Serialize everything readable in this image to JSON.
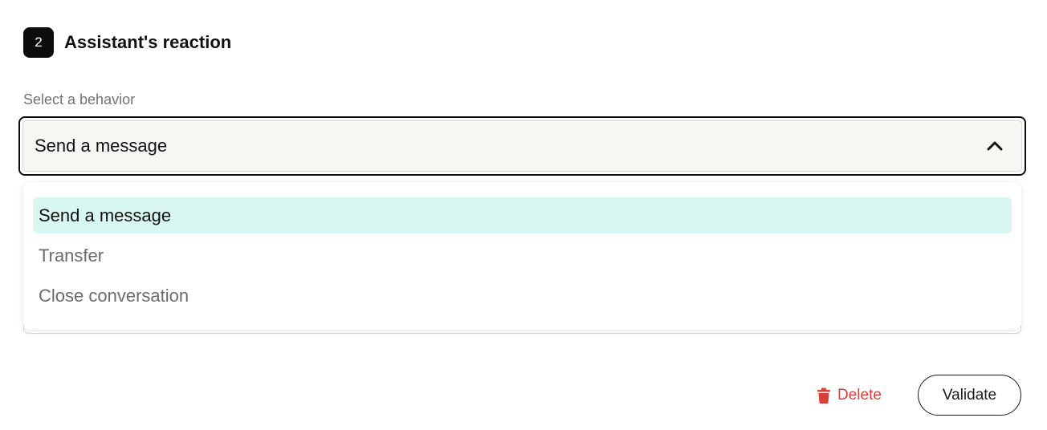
{
  "section": {
    "step_number": "2",
    "title": "Assistant's reaction"
  },
  "behavior_select": {
    "label": "Select a behavior",
    "selected_value": "Send a message",
    "options": [
      {
        "label": "Send a message",
        "selected": true
      },
      {
        "label": "Transfer",
        "selected": false
      },
      {
        "label": "Close conversation",
        "selected": false
      }
    ]
  },
  "actions": {
    "delete_label": "Delete",
    "validate_label": "Validate"
  },
  "colors": {
    "accent_selected_bg": "#d8f7f2",
    "delete_red": "#d9403a",
    "badge_bg": "#0d0d0d"
  },
  "icons": {
    "chevron": "chevron-up-icon",
    "delete": "trash-icon"
  }
}
